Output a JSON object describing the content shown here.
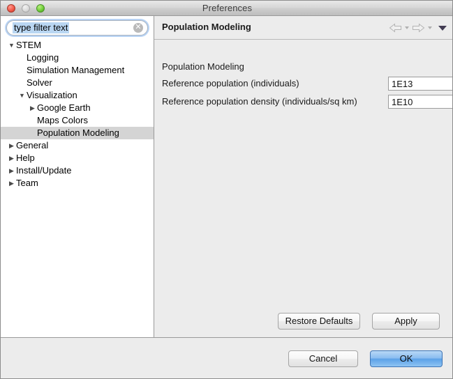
{
  "window": {
    "title": "Preferences",
    "controls": {
      "close": "close-button",
      "minimize": "minimize-button",
      "zoom": "zoom-button"
    }
  },
  "filter": {
    "value": "type filter text",
    "placeholder": "type filter text",
    "clear_glyph": "✕"
  },
  "tree": {
    "items": [
      {
        "label": "STEM",
        "depth": 0,
        "twisty": "open",
        "selected": false
      },
      {
        "label": "Logging",
        "depth": 1,
        "twisty": "none",
        "selected": false
      },
      {
        "label": "Simulation Management",
        "depth": 1,
        "twisty": "none",
        "selected": false
      },
      {
        "label": "Solver",
        "depth": 1,
        "twisty": "none",
        "selected": false
      },
      {
        "label": "Visualization",
        "depth": 1,
        "twisty": "open",
        "selected": false
      },
      {
        "label": "Google Earth",
        "depth": 2,
        "twisty": "closed",
        "selected": false
      },
      {
        "label": "Maps Colors",
        "depth": 2,
        "twisty": "none",
        "selected": false
      },
      {
        "label": "Population Modeling",
        "depth": 2,
        "twisty": "none",
        "selected": true
      },
      {
        "label": "General",
        "depth": 0,
        "twisty": "closed",
        "selected": false
      },
      {
        "label": "Help",
        "depth": 0,
        "twisty": "closed",
        "selected": false
      },
      {
        "label": "Install/Update",
        "depth": 0,
        "twisty": "closed",
        "selected": false
      },
      {
        "label": "Team",
        "depth": 0,
        "twisty": "closed",
        "selected": false
      }
    ]
  },
  "content": {
    "title": "Population Modeling",
    "section_label": "Population Modeling",
    "nav": {
      "back": "back-arrow",
      "forward": "forward-arrow",
      "menu": "view-menu-chevron"
    },
    "fields": [
      {
        "label": "Reference population (individuals)",
        "value": "1E13"
      },
      {
        "label": "Reference population density (individuals/sq km)",
        "value": "1E10"
      }
    ]
  },
  "buttons": {
    "restore_defaults": "Restore Defaults",
    "apply": "Apply",
    "cancel": "Cancel",
    "ok": "OK"
  },
  "colors": {
    "window_bg": "#ececec",
    "tree_bg": "#ffffff",
    "selection": "#d4d4d4",
    "filter_selection": "#b9d6f2",
    "default_button_blue": "#5ca2e8"
  }
}
